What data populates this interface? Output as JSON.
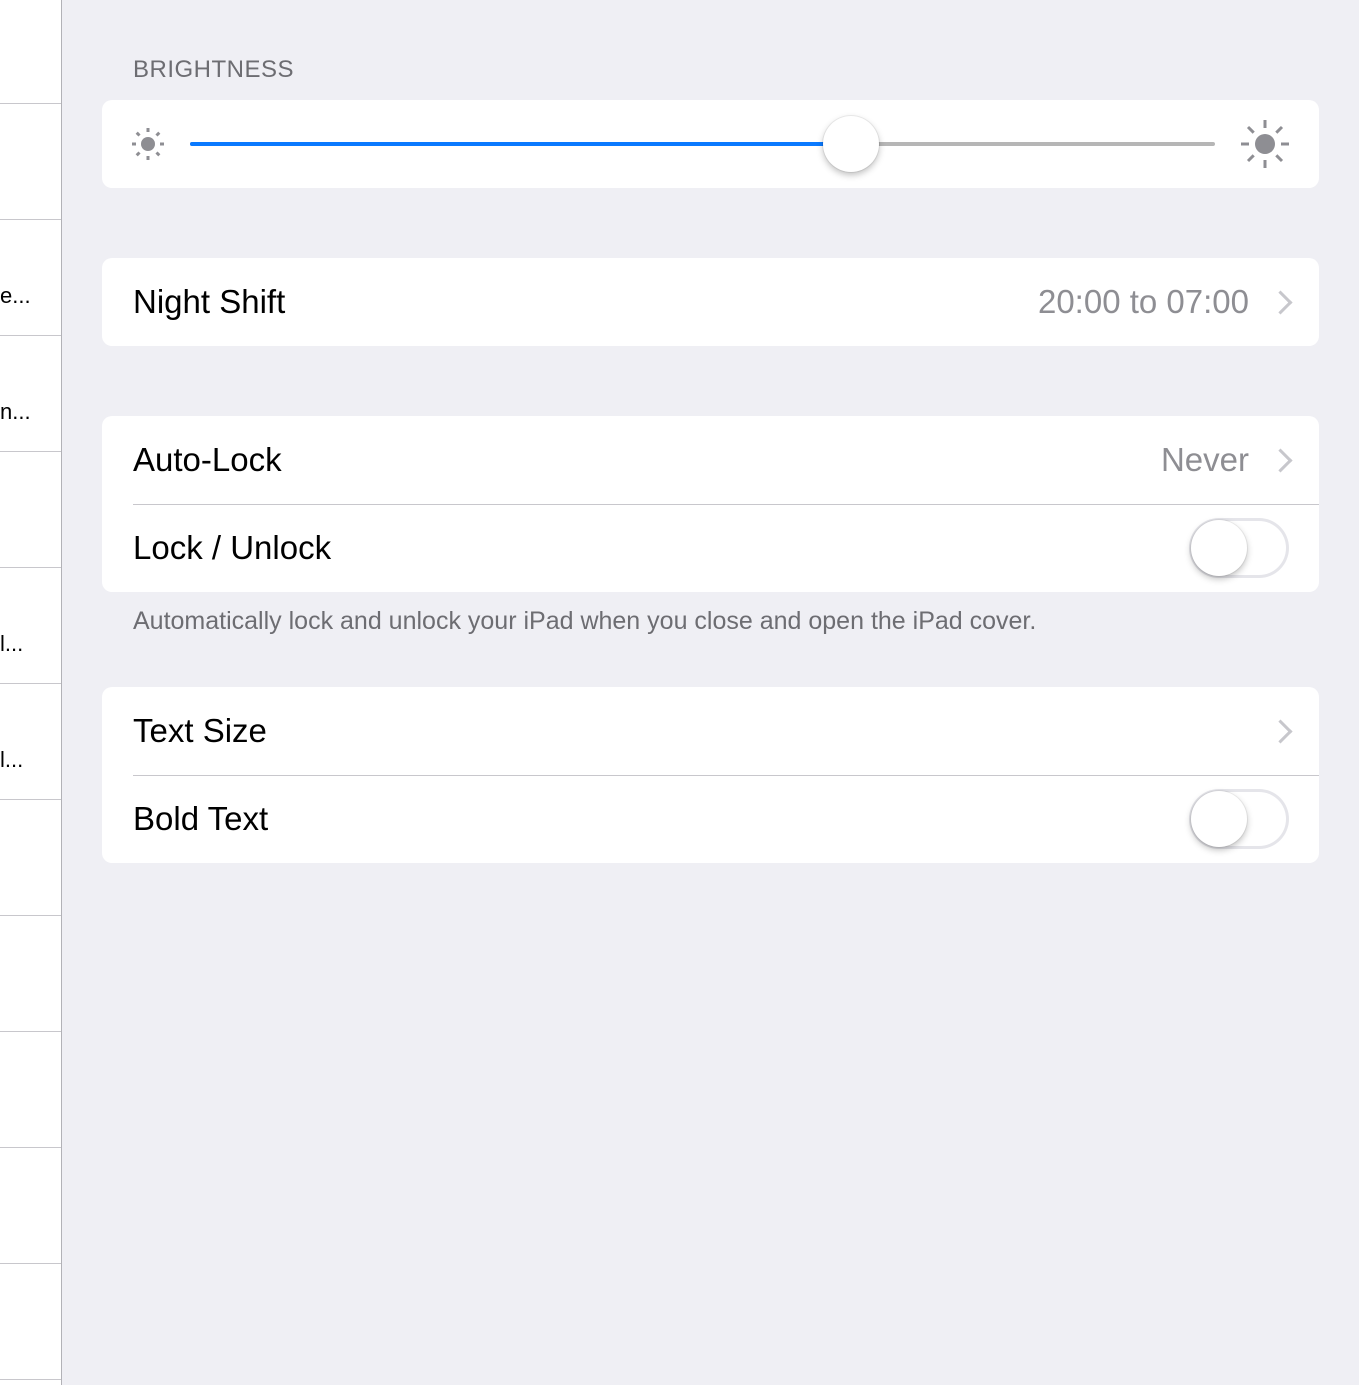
{
  "sidebar": {
    "rows": [
      {
        "text": ""
      },
      {
        "text": ""
      },
      {
        "text": "e..."
      },
      {
        "text": "n..."
      },
      {
        "text": ""
      },
      {
        "text": "l..."
      },
      {
        "text": "l..."
      },
      {
        "text": ""
      },
      {
        "text": ""
      },
      {
        "text": ""
      },
      {
        "text": ""
      },
      {
        "text": ""
      }
    ]
  },
  "brightness": {
    "header": "BRIGHTNESS",
    "level": 0.645,
    "min_icon": "sun-small-icon",
    "max_icon": "sun-large-icon",
    "fill_color": "#0a7aff"
  },
  "night_shift": {
    "label": "Night Shift",
    "value": "20:00 to 07:00"
  },
  "lock_group": {
    "auto_lock_label": "Auto-Lock",
    "auto_lock_value": "Never",
    "lock_unlock_label": "Lock / Unlock",
    "lock_unlock_on": false,
    "footer": "Automatically lock and unlock your iPad when you close and open the iPad cover."
  },
  "text_group": {
    "text_size_label": "Text Size",
    "bold_text_label": "Bold Text",
    "bold_text_on": false
  }
}
